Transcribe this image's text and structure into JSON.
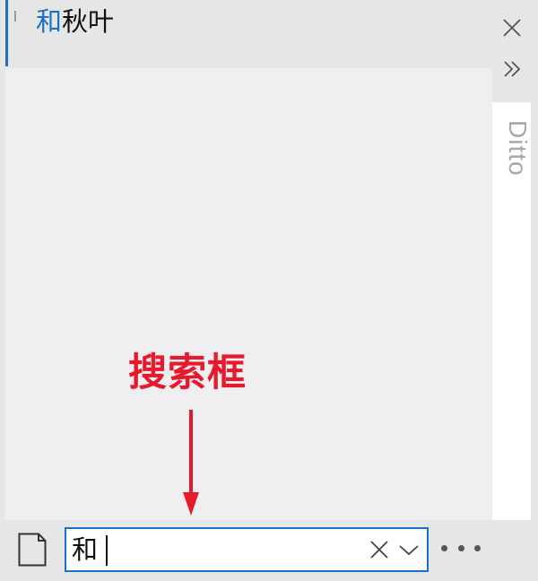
{
  "clip": {
    "match_text": "和",
    "rest_text": "秋叶"
  },
  "side_tab": {
    "label": "Ditto"
  },
  "annotation": {
    "label": "搜索框"
  },
  "search": {
    "value": "和"
  },
  "icons": {
    "close": "close-icon",
    "expand": "double-chevron-right-icon",
    "document": "document-icon",
    "clear": "clear-icon",
    "dropdown": "chevron-down-icon",
    "more": "more-icon",
    "arrow": "arrow-down-icon"
  },
  "colors": {
    "accent": "#1a6fc6",
    "annotation": "#e8192c",
    "background": "#e6e6e6",
    "list_background": "#efeff1",
    "side_label": "#a8a8a8"
  }
}
